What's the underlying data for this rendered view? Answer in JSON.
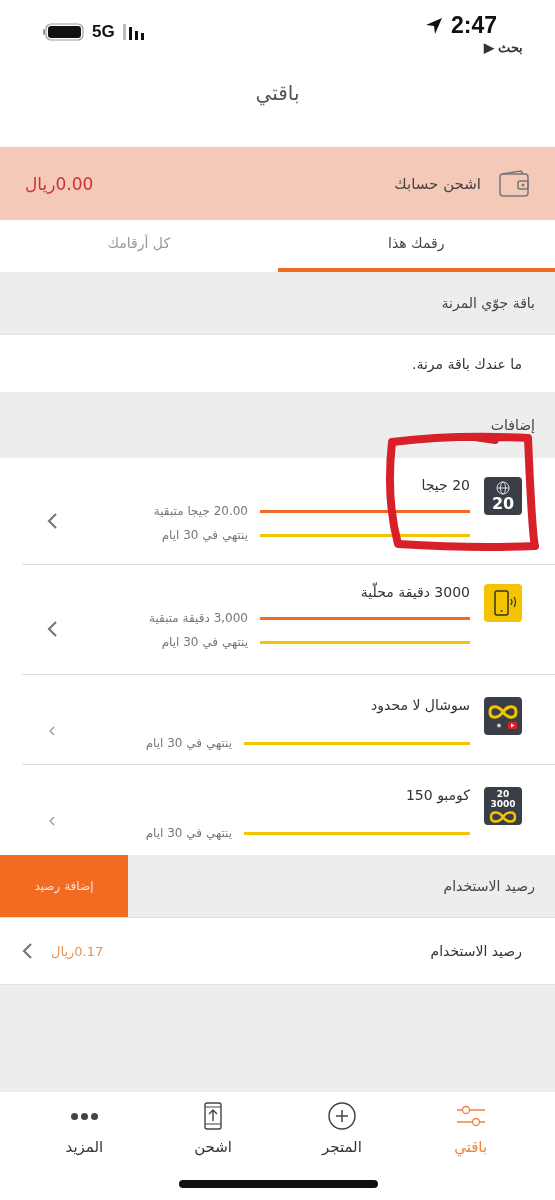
{
  "status_bar": {
    "time": "2:47",
    "network": "5G",
    "back_arrow": "▶",
    "back_label": "بحث"
  },
  "title": "باقتي",
  "account": {
    "label": "اشحن حسابك",
    "balance": "0.00ريال"
  },
  "tabs": [
    {
      "label": "رقمك هذا",
      "selected": true
    },
    {
      "label": "كل أرقامك",
      "selected": false
    }
  ],
  "flex_plan": {
    "heading": "باقة جوّي المرنة",
    "message": "ما عندك باقة مرنة."
  },
  "addons": {
    "heading": "إضافات",
    "items": [
      {
        "title": "20 جيجا",
        "kind": "data",
        "badge": [
          "20"
        ],
        "bars": [
          {
            "kind": "remaining",
            "level": 1,
            "label": "20.00 جيجا متبقية"
          },
          {
            "kind": "validity",
            "level": 1,
            "label": "ينتهي في 30 ايام"
          }
        ]
      },
      {
        "title": "3000 دقيقة محلّية",
        "kind": "minutes",
        "bars": [
          {
            "kind": "remaining",
            "level": 1,
            "label": "3,000 دقيقة متبقية"
          },
          {
            "kind": "validity",
            "level": 1,
            "label": "ينتهي في 30 ايام"
          }
        ]
      },
      {
        "title": "سوشال لا محدود",
        "kind": "social",
        "bars": [
          {
            "kind": "validity",
            "level": 1,
            "label": "ينتهي في 30 ايام"
          }
        ]
      },
      {
        "title": "كومبو 150",
        "kind": "combo",
        "badge": [
          "20",
          "3000"
        ],
        "bars": [
          {
            "kind": "validity",
            "level": 1,
            "label": "ينتهي في 30 ايام"
          }
        ]
      }
    ]
  },
  "usage": {
    "heading": "رصيد الاستخدام",
    "button": "إضافة رصيد",
    "row_label": "رصيد الاستخدام",
    "amount": "0.17ريال"
  },
  "nav": [
    {
      "label": "باقتي",
      "kind": "plan",
      "selected": true
    },
    {
      "label": "المتجر",
      "kind": "store",
      "selected": false
    },
    {
      "label": "اشحن",
      "kind": "recharge",
      "selected": false
    },
    {
      "label": "المزيد",
      "kind": "more",
      "selected": false
    }
  ]
}
